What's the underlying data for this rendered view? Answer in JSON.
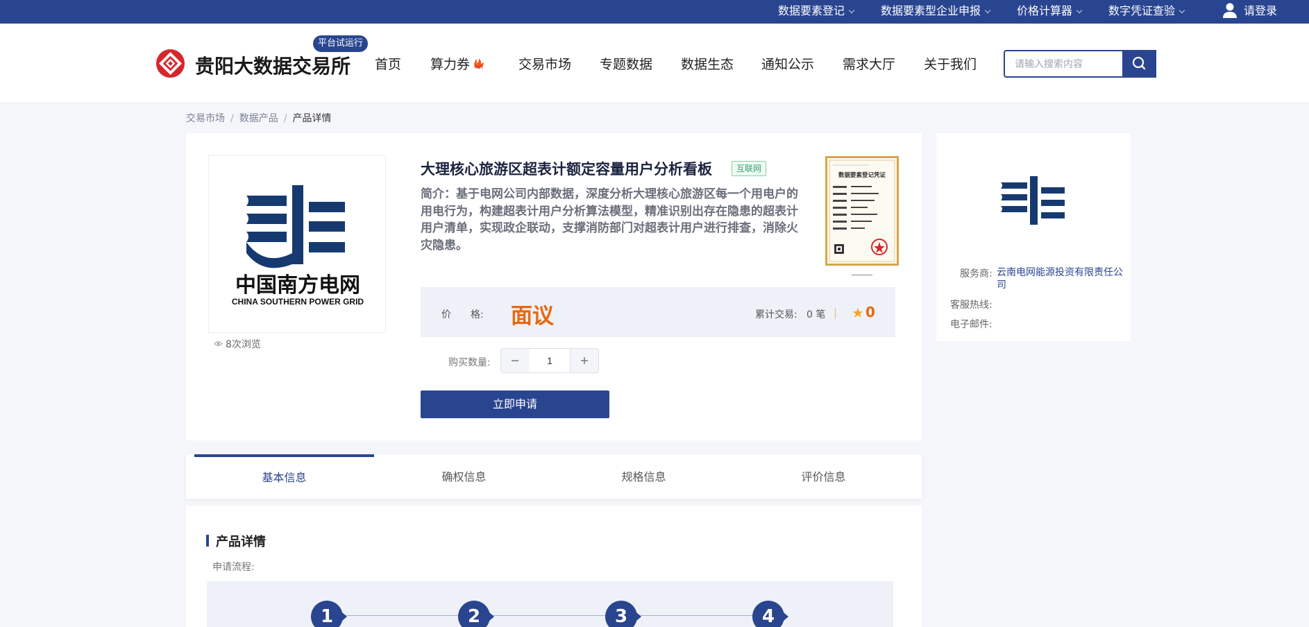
{
  "topbar": {
    "items": [
      {
        "label": "数据要素登记"
      },
      {
        "label": "数据要素型企业申报"
      },
      {
        "label": "价格计算器"
      },
      {
        "label": "数字凭证查验"
      }
    ],
    "login_label": "请登录"
  },
  "header": {
    "logo_text": "贵阳大数据交易所",
    "trial_badge": "平台试运行",
    "nav": [
      {
        "label": "首页"
      },
      {
        "label": "算力券"
      },
      {
        "label": "交易市场"
      },
      {
        "label": "专题数据"
      },
      {
        "label": "数据生态"
      },
      {
        "label": "通知公示"
      },
      {
        "label": "需求大厅"
      },
      {
        "label": "关于我们"
      }
    ],
    "hot_text": "HOT",
    "search": {
      "placeholder": "请输入搜索内容",
      "value": ""
    }
  },
  "breadcrumb": [
    "交易市场",
    "数据产品",
    "产品详情"
  ],
  "product": {
    "logo_cn": "中国南方电网",
    "logo_en": "CHINA SOUTHERN POWER GRID",
    "views": "8次浏览",
    "title": "大理核心旅游区超表计额定容量用户分析看板",
    "tag": "互联网",
    "description": "简介：基于电网公司内部数据，深度分析大理核心旅游区每一个用电户的用电行为，构建超表计用户分析算法模型，精准识别出存在隐患的超表计用户清单，实现政企联动，支撑消防部门对超表计用户进行排查，消除火灾隐患。",
    "cert_title": "数据要素登记凭证",
    "price_label": "价　　格:",
    "price_value": "面议",
    "trade_label": "累计交易:",
    "trade_value": "0 笔",
    "score": "0",
    "qty_label": "购买数量:",
    "qty_value": "1",
    "apply_label": "立即申请"
  },
  "provider": {
    "service_label": "服务商:",
    "service_value": "云南电网能源投资有限责任公司",
    "hotline_label": "客服热线:",
    "email_label": "电子邮件:"
  },
  "tabs": [
    {
      "label": "基本信息"
    },
    {
      "label": "确权信息"
    },
    {
      "label": "规格信息"
    },
    {
      "label": "评价信息"
    }
  ],
  "detail": {
    "title": "产品详情",
    "flow_label": "申请流程:",
    "steps": [
      "1",
      "2",
      "3",
      "4"
    ]
  },
  "colors": {
    "brand": "#2a4590",
    "accent": "#e8680f",
    "tag_green": "#33a56a",
    "logo_red": "#d7262b"
  }
}
